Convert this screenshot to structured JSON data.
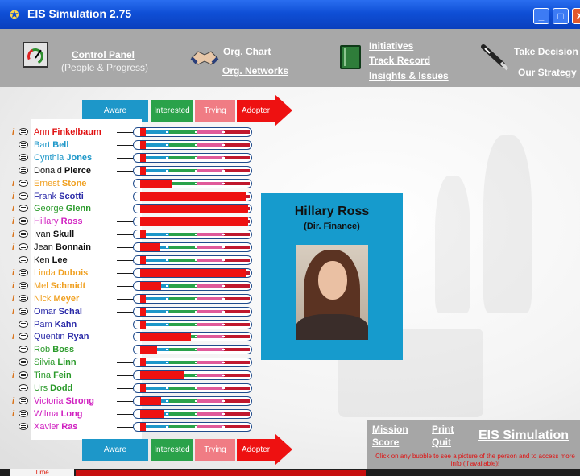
{
  "window": {
    "title": "EIS Simulation 2.75"
  },
  "toolbar": {
    "control_panel": "Control Panel",
    "control_panel_sub": "(People & Progress)",
    "org_chart": "Org. Chart",
    "org_networks": "Org. Networks",
    "initiatives": "Initiatives",
    "track_record": "Track Record",
    "insights": "Insights & Issues",
    "take_decision": "Take Decision",
    "our_strategy": "Our Strategy"
  },
  "stages": {
    "aware": "Aware",
    "interested": "Interested",
    "trying": "Trying",
    "adopter": "Adopter"
  },
  "people": [
    {
      "first": "Ann",
      "last": "Finkelbaum",
      "color": "#e01010",
      "info": true,
      "progress": 0.05
    },
    {
      "first": "Bart",
      "last": "Bell",
      "color": "#1d97c9",
      "info": false,
      "progress": 0.05
    },
    {
      "first": "Cynthia",
      "last": "Jones",
      "color": "#1d97c9",
      "info": false,
      "progress": 0.05
    },
    {
      "first": "Donald",
      "last": "Pierce",
      "color": "#111111",
      "info": false,
      "progress": 0.05
    },
    {
      "first": "Ernest",
      "last": "Stone",
      "color": "#f0a020",
      "info": true,
      "progress": 0.28
    },
    {
      "first": "Frank",
      "last": "Scotti",
      "color": "#2a2aa8",
      "info": true,
      "progress": 0.96
    },
    {
      "first": "George",
      "last": "Glenn",
      "color": "#2a9a2a",
      "info": true,
      "progress": 0.97
    },
    {
      "first": "Hillary",
      "last": "Ross",
      "color": "#d020c0",
      "info": true,
      "progress": 0.97
    },
    {
      "first": "Ivan",
      "last": "Skull",
      "color": "#111111",
      "info": true,
      "progress": 0.05
    },
    {
      "first": "Jean",
      "last": "Bonnain",
      "color": "#111111",
      "info": true,
      "progress": 0.18
    },
    {
      "first": "Ken",
      "last": "Lee",
      "color": "#111111",
      "info": false,
      "progress": 0.05
    },
    {
      "first": "Linda",
      "last": "Dubois",
      "color": "#f0a020",
      "info": true,
      "progress": 0.96
    },
    {
      "first": "Mel",
      "last": "Schmidt",
      "color": "#f0a020",
      "info": true,
      "progress": 0.19
    },
    {
      "first": "Nick",
      "last": "Meyer",
      "color": "#f0a020",
      "info": true,
      "progress": 0.05
    },
    {
      "first": "Omar",
      "last": "Schal",
      "color": "#2a2aa8",
      "info": true,
      "progress": 0.05
    },
    {
      "first": "Pam",
      "last": "Kahn",
      "color": "#2a2aa8",
      "info": false,
      "progress": 0.05
    },
    {
      "first": "Quentin",
      "last": "Ryan",
      "color": "#2a2aa8",
      "info": true,
      "progress": 0.46
    },
    {
      "first": "Rob",
      "last": "Boss",
      "color": "#2a9a2a",
      "info": false,
      "progress": 0.15
    },
    {
      "first": "Silvia",
      "last": "Linn",
      "color": "#2a9a2a",
      "info": false,
      "progress": 0.05
    },
    {
      "first": "Tina",
      "last": "Fein",
      "color": "#2a9a2a",
      "info": true,
      "progress": 0.4
    },
    {
      "first": "Urs",
      "last": "Dodd",
      "color": "#2a9a2a",
      "info": false,
      "progress": 0.05
    },
    {
      "first": "Victoria",
      "last": "Strong",
      "color": "#d020c0",
      "info": true,
      "progress": 0.19
    },
    {
      "first": "Wilma",
      "last": "Long",
      "color": "#d020c0",
      "info": true,
      "progress": 0.22
    },
    {
      "first": "Xavier",
      "last": "Ras",
      "color": "#d020c0",
      "info": false,
      "progress": 0.05
    }
  ],
  "profile": {
    "name": "Hillary Ross",
    "role": "(Dir. Finance)"
  },
  "bottom": {
    "mission": "Mission",
    "score": "Score",
    "print": "Print",
    "quit": "Quit",
    "brand": "EIS Simulation",
    "help": "Click on any bubble to see a picture of the person and to access more info (if available)!"
  },
  "status": {
    "tab": "Time"
  }
}
